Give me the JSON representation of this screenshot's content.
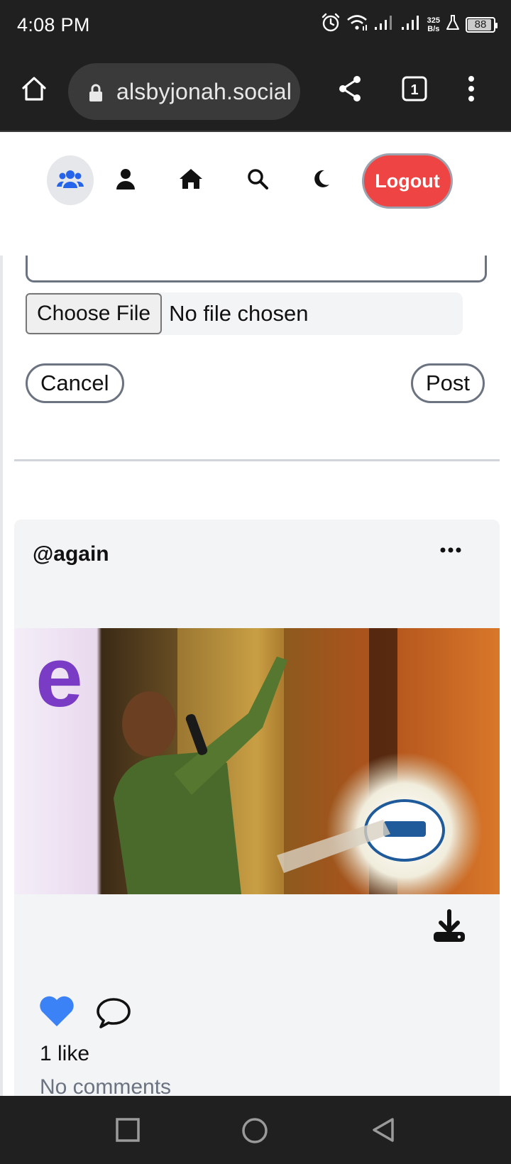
{
  "status_bar": {
    "time": "4:08 PM",
    "net_speed_value": "325",
    "net_speed_unit": "B/s",
    "battery": "88",
    "icons": [
      "alarm-icon",
      "wifi-icon",
      "signal-icon",
      "signal-icon",
      "lab-flask-icon",
      "battery-icon"
    ]
  },
  "browser": {
    "url": "alsbyjonah.social",
    "tab_count": "1",
    "icons": [
      "home-icon",
      "lock-icon",
      "share-icon",
      "tabs-icon",
      "more-vert-icon"
    ]
  },
  "nav": {
    "items": [
      {
        "name": "friends",
        "icon": "users-icon",
        "active": true
      },
      {
        "name": "profile",
        "icon": "user-icon",
        "active": false
      },
      {
        "name": "home",
        "icon": "home-icon",
        "active": false
      },
      {
        "name": "search",
        "icon": "search-icon",
        "active": false
      },
      {
        "name": "theme",
        "icon": "moon-icon",
        "active": false
      }
    ],
    "logout_label": "Logout",
    "accent": "#2563eb",
    "logout_color": "#ef4444"
  },
  "composer": {
    "choose_file_label": "Choose File",
    "file_status": "No file chosen",
    "cancel_label": "Cancel",
    "post_label": "Post"
  },
  "post": {
    "username": "@again",
    "likes_text": "1 like",
    "comments_text": "No comments",
    "liked": true,
    "like_color": "#3b82f6",
    "icons": [
      "more-horizontal-icon",
      "download-icon",
      "heart-icon",
      "comment-icon"
    ]
  },
  "system_nav": {
    "icons": [
      "recents-icon",
      "home-circle-icon",
      "back-icon"
    ]
  }
}
